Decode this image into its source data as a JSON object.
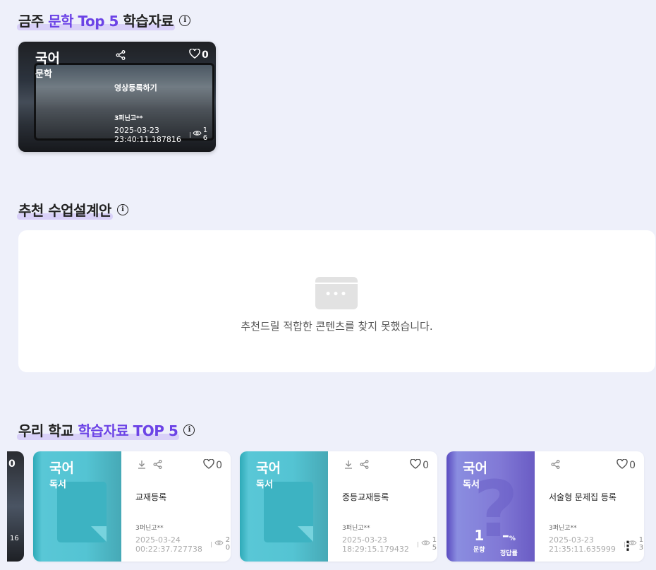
{
  "section1": {
    "title_plain_1": "금주 ",
    "title_accent": "문학 Top 5",
    "title_plain_2": " 학습자료",
    "info": "i"
  },
  "video_card": {
    "subject": "국어",
    "sub_subject": "문학",
    "title": "영상등록하기",
    "author": "3퍼닌고**",
    "date": "2025-03-23 23:40:11.187816",
    "likes": "0",
    "views": "16",
    "share_icon": "share-icon",
    "like_icon": "heart-icon",
    "view_icon": "eye-icon"
  },
  "section2": {
    "title": "추천 수업설계안",
    "info": "i",
    "empty_text": "추천드릴 적합한 콘텐츠를 찾지 못했습니다.",
    "empty_dots": "•••"
  },
  "section3": {
    "title_plain": "우리 학교 ",
    "title_accent": "학습자료 TOP 5",
    "info": "i"
  },
  "partial_card": {
    "likes": "0",
    "views": "16"
  },
  "cards": [
    {
      "subject": "국어",
      "sub_subject": "독서",
      "title": "교재등록",
      "author": "3퍼닌고**",
      "date": "2025-03-24 00:22:37.727738",
      "likes": "0",
      "views": "20"
    },
    {
      "subject": "국어",
      "sub_subject": "독서",
      "title": "중등교재등록",
      "author": "3퍼닌고**",
      "date": "2025-03-23 18:29:15.179432",
      "likes": "0",
      "views": "15"
    },
    {
      "subject": "국어",
      "sub_subject": "독서",
      "title": "서술형 문제집 등록",
      "author": "3퍼닌고**",
      "date": "2025-03-23 21:35:11.635999",
      "likes": "0",
      "views": "13",
      "stat_count": "1",
      "stat_count_label": "문항",
      "stat_rate": "–",
      "stat_rate_unit": "%",
      "stat_rate_label": "정답률"
    }
  ],
  "icons": {
    "download": "↓",
    "share": "⋖",
    "heart": "♡",
    "more": "⋮"
  },
  "colors": {
    "accent": "#6c43e6",
    "highlight": "#d9d1f8",
    "teal": "#54c4d3",
    "purple": "#8179d6",
    "background": "#eef0fa"
  }
}
